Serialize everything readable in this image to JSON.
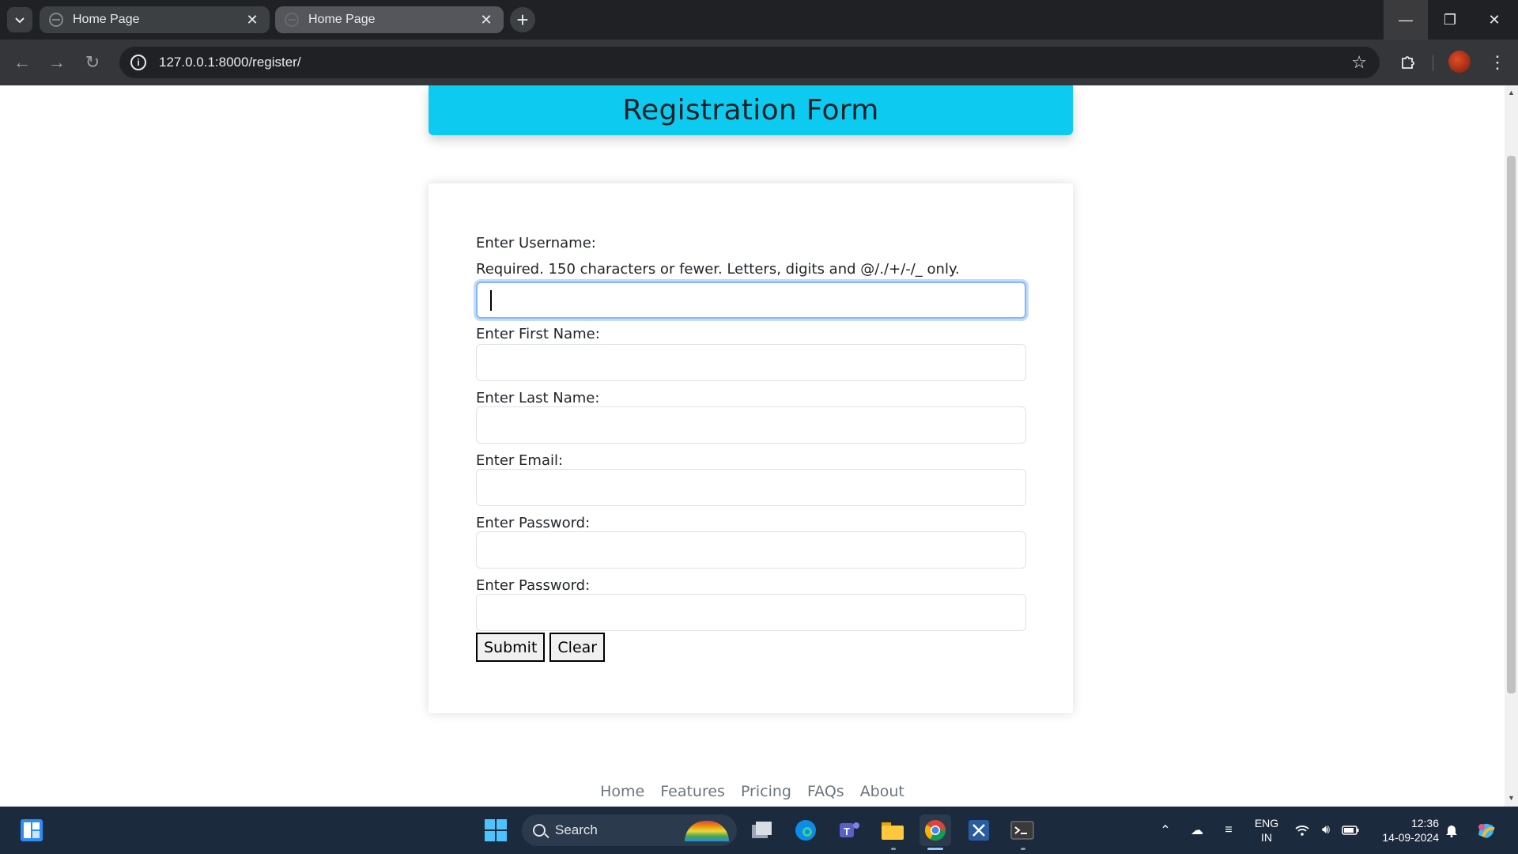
{
  "browser": {
    "tabs": [
      {
        "title": "Home Page",
        "active": true
      },
      {
        "title": "Home Page",
        "active": false
      }
    ],
    "url": "127.0.0.1:8000/register/"
  },
  "page": {
    "title": "Registration Form",
    "form": {
      "username_label": "Enter Username:",
      "username_help": "Required. 150 characters or fewer. Letters, digits and @/./+/-/_ only.",
      "first_name_label": "Enter First Name:",
      "last_name_label": "Enter Last Name:",
      "email_label": "Enter Email:",
      "password_label": "Enter Password:",
      "password_confirm_label": "Enter Password:",
      "submit_label": "Submit",
      "clear_label": "Clear"
    },
    "footer_links": [
      "Home",
      "Features",
      "Pricing",
      "FAQs",
      "About"
    ]
  },
  "taskbar": {
    "search_placeholder": "Search",
    "language": "ENG",
    "region": "IN",
    "time": "12:36",
    "date": "14-09-2024"
  },
  "colors": {
    "header_bg": "#0dcaf0",
    "focus_ring": "#86b7fe",
    "taskbar_bg": "#1c2a3d"
  }
}
